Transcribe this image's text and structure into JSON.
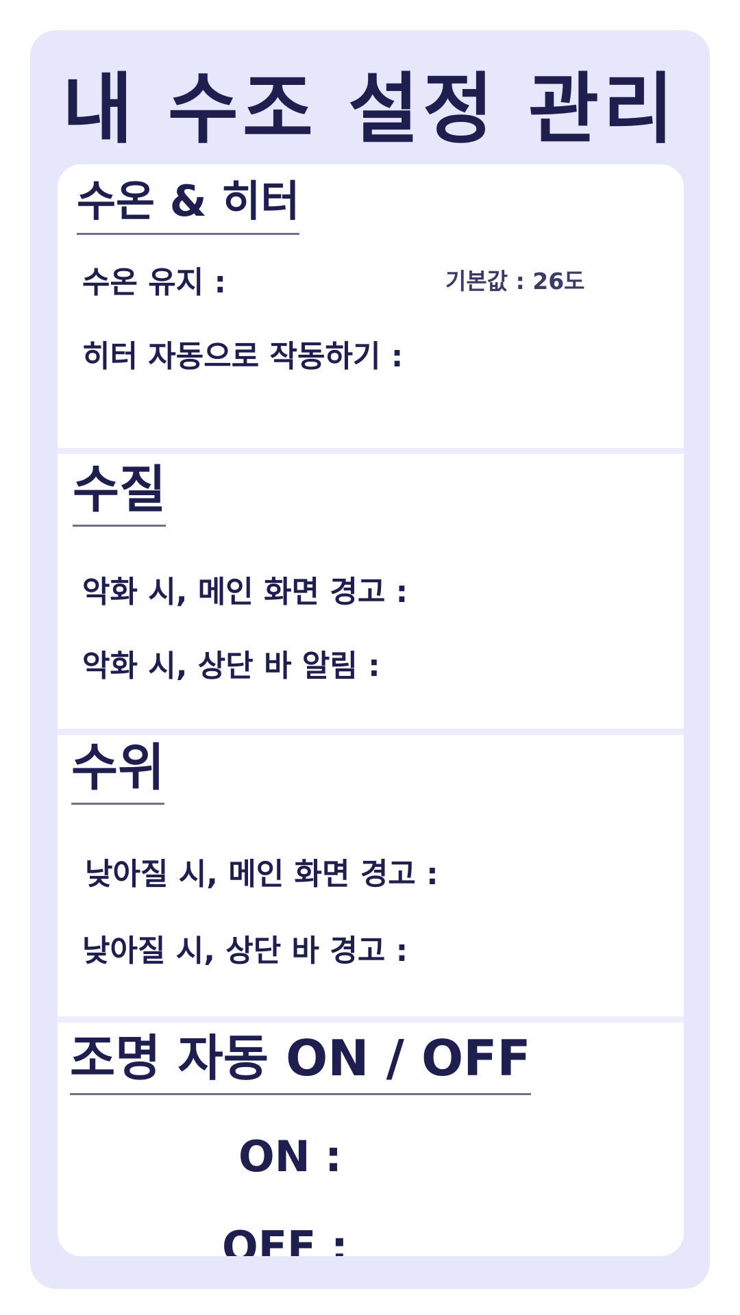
{
  "title": "내 수조 설정 관리",
  "sections": {
    "temperature": {
      "title": "수온 & 히터",
      "items": {
        "keep_temp": {
          "label": "수온 유지 :",
          "default_text": "기본값 : 26도"
        },
        "heater_auto": {
          "label": "히터 자동으로 작동하기 :"
        }
      }
    },
    "water_quality": {
      "title": "수질",
      "items": {
        "main_warning": {
          "label": "악화 시, 메인 화면 경고 :"
        },
        "bar_alert": {
          "label": "악화 시, 상단 바 알림 :"
        }
      }
    },
    "water_level": {
      "title": "수위",
      "items": {
        "main_warning": {
          "label": "낮아질 시, 메인 화면 경고 :"
        },
        "bar_warning": {
          "label": "낮아질 시, 상단 바 경고 :"
        }
      }
    },
    "lighting": {
      "title": "조명 자동 ON / OFF",
      "items": {
        "on": {
          "label": "ON :"
        },
        "off": {
          "label": "OFF :"
        }
      }
    }
  },
  "colors": {
    "page_background": "#ffffff",
    "frame_background": "#e7e7fb",
    "card_background": "#ffffff",
    "divider": "#ececfa",
    "text": "#1f1f4f",
    "underline": "#6f6f8c"
  }
}
